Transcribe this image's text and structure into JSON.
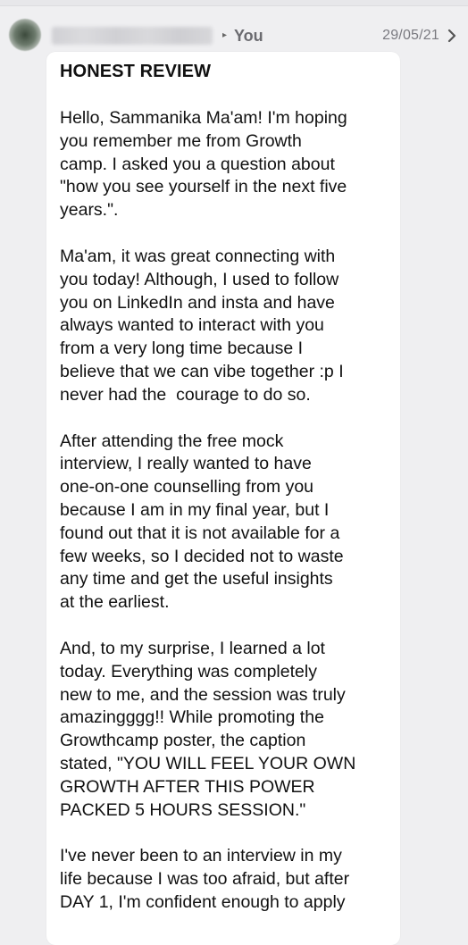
{
  "header": {
    "avatar_icon": "avatar-blurred",
    "sender_label": "You",
    "date": "29/05/21",
    "arrow_icon": "small-right-arrow-icon",
    "chevron_icon": "chevron-right-icon"
  },
  "message": {
    "title": "HONEST REVIEW",
    "paragraphs": [
      "Hello, Sammanika Ma'am! I'm hoping\nyou remember me from Growth\ncamp. I asked you a question about\n\"how you see yourself in the next five\nyears.\".",
      "Ma'am, it was great connecting with\nyou today! Although, I used to follow\nyou on LinkedIn and insta and have\nalways wanted to interact with you\nfrom a very long time because I\nbelieve that we can vibe together :p I\nnever had the  courage to do so.",
      "After attending the free mock\ninterview, I really wanted to have\none-on-one counselling from you\nbecause I am in my final year, but I\nfound out that it is not available for a\nfew weeks, so I decided not to waste\nany time and get the useful insights\nat the earliest.",
      "And, to my surprise, I learned a lot\ntoday. Everything was completely\nnew to me, and the session was truly\namazingggg!! While promoting the\nGrowthcamp poster, the caption\nstated, \"YOU WILL FEEL YOUR OWN\nGROWTH AFTER THIS POWER\nPACKED 5 HOURS SESSION.\"",
      "I've never been to an interview in my\nlife because I was too afraid, but after\nDAY 1, I'm confident enough to apply"
    ]
  },
  "colors": {
    "background": "#efeff1",
    "bubble": "#ffffff",
    "text": "#111111",
    "meta_text": "#7a7a80"
  }
}
